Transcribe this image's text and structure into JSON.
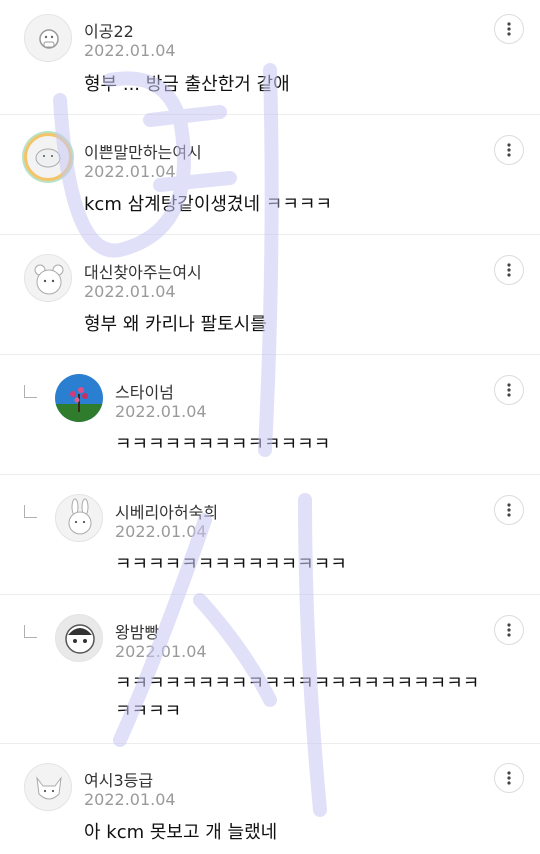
{
  "comments": [
    {
      "nickname": "이공22",
      "date": "2022.01.04",
      "lines": [
        "형부 ... 방금 출산한거 같애"
      ],
      "avatar_icon": "animal-sticker-avatar",
      "reply": false
    },
    {
      "nickname": "이쁜말만하는여시",
      "date": "2022.01.04",
      "lines": [
        "kcm 삼계탕같이생겼네 ㅋㅋㅋㅋ"
      ],
      "avatar_icon": "rainbow-ring-avatar",
      "reply": false
    },
    {
      "nickname": "대신찾아주는여시",
      "date": "2022.01.04",
      "lines": [
        "형부 왜 카리나 팔토시를"
      ],
      "avatar_icon": "bear-avatar",
      "reply": false
    },
    {
      "nickname": "스타이넘",
      "date": "2022.01.04",
      "lines": [
        "ㅋㅋㅋㅋㅋㅋㅋㅋㅋㅋㅋㅋㅋ"
      ],
      "avatar_icon": "flower-photo-avatar",
      "reply": true
    },
    {
      "nickname": "시베리아허숙희",
      "date": "2022.01.04",
      "lines": [
        "ㅋㅋㅋㅋㅋㅋㅋㅋㅋㅋㅋㅋㅋㅋ"
      ],
      "avatar_icon": "bunny-avatar",
      "reply": true
    },
    {
      "nickname": "왕밤빵",
      "date": "2022.01.04",
      "lines": [
        "ㅋㅋㅋㅋㅋㅋㅋㅋㅋㅋㅋㅋㅋㅋㅋㅋㅋㅋㅋㅋㅋㅋ",
        "ㅋㅋㅋㅋ"
      ],
      "avatar_icon": "character-avatar",
      "reply": true
    },
    {
      "nickname": "여시3등급",
      "date": "2022.01.04",
      "lines": [
        "아 kcm 못보고 개 늘랬네"
      ],
      "avatar_icon": "fox-avatar",
      "reply": false
    }
  ],
  "watermark_text": "여시",
  "colors": {
    "watermark": "#c7c8f3",
    "date": "#9a9a9a",
    "divider": "#ececec"
  }
}
